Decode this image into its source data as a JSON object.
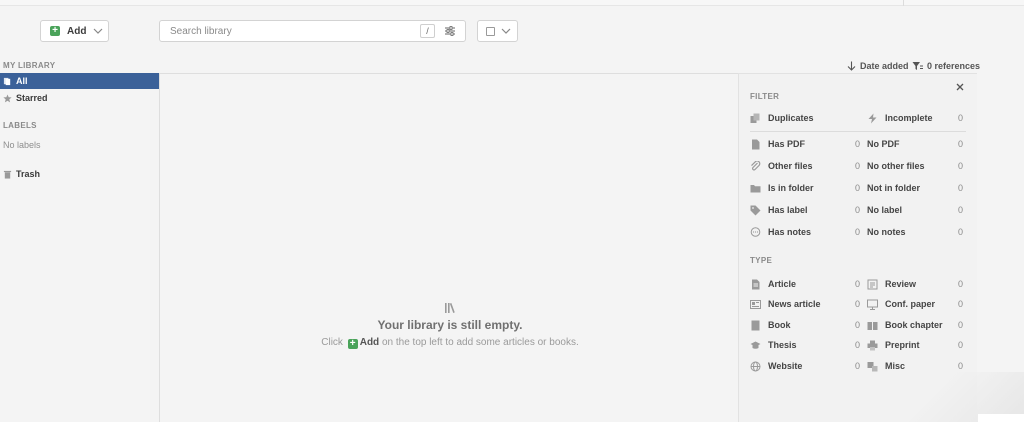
{
  "toolbar": {
    "add_label": "Add",
    "search_placeholder": "Search library",
    "search_key": "/"
  },
  "sidebar": {
    "my_library_title": "MY LIBRARY",
    "items": [
      {
        "label": "All",
        "active": true,
        "icon": "library-icon"
      },
      {
        "label": "Starred",
        "active": false,
        "icon": "star-icon"
      }
    ],
    "labels_title": "LABELS",
    "no_labels": "No labels",
    "trash_label": "Trash"
  },
  "sort": {
    "label": "Date added",
    "references": "0 references"
  },
  "empty_state": {
    "title": "Your library is still empty.",
    "hint_prefix": "Click",
    "hint_add": "Add",
    "hint_suffix": "on the top left to add some articles or books."
  },
  "filter_panel": {
    "filter_title": "FILTER",
    "type_title": "TYPE",
    "top": [
      {
        "label": "Duplicates",
        "count": "",
        "icon": "duplicates-icon"
      },
      {
        "label": "Incomplete",
        "count": "0",
        "icon": "lightning-icon"
      }
    ],
    "pairs": [
      {
        "left": {
          "label": "Has PDF",
          "count": "0",
          "icon": "document-icon"
        },
        "right": {
          "label": "No PDF",
          "count": "0"
        }
      },
      {
        "left": {
          "label": "Other files",
          "count": "0",
          "icon": "paperclip-icon"
        },
        "right": {
          "label": "No other files",
          "count": "0"
        }
      },
      {
        "left": {
          "label": "Is in folder",
          "count": "0",
          "icon": "folder-icon"
        },
        "right": {
          "label": "Not in folder",
          "count": "0"
        }
      },
      {
        "left": {
          "label": "Has label",
          "count": "0",
          "icon": "tag-icon"
        },
        "right": {
          "label": "No label",
          "count": "0"
        }
      },
      {
        "left": {
          "label": "Has notes",
          "count": "0",
          "icon": "speech-bubble-icon"
        },
        "right": {
          "label": "No notes",
          "count": "0"
        }
      }
    ],
    "types": [
      {
        "left": {
          "label": "Article",
          "count": "0",
          "icon": "article-icon"
        },
        "right": {
          "label": "Review",
          "count": "0",
          "icon": "review-icon"
        }
      },
      {
        "left": {
          "label": "News article",
          "count": "0",
          "icon": "newspaper-icon"
        },
        "right": {
          "label": "Conf. paper",
          "count": "0",
          "icon": "conference-icon"
        }
      },
      {
        "left": {
          "label": "Book",
          "count": "0",
          "icon": "book-icon"
        },
        "right": {
          "label": "Book chapter",
          "count": "0",
          "icon": "open-book-icon"
        }
      },
      {
        "left": {
          "label": "Thesis",
          "count": "0",
          "icon": "graduation-cap-icon"
        },
        "right": {
          "label": "Preprint",
          "count": "0",
          "icon": "printer-icon"
        }
      },
      {
        "left": {
          "label": "Website",
          "count": "0",
          "icon": "globe-icon"
        },
        "right": {
          "label": "Misc",
          "count": "0",
          "icon": "misc-icon"
        }
      }
    ]
  },
  "colors": {
    "accent": "#3b6199",
    "add_green": "#4aa35a"
  }
}
